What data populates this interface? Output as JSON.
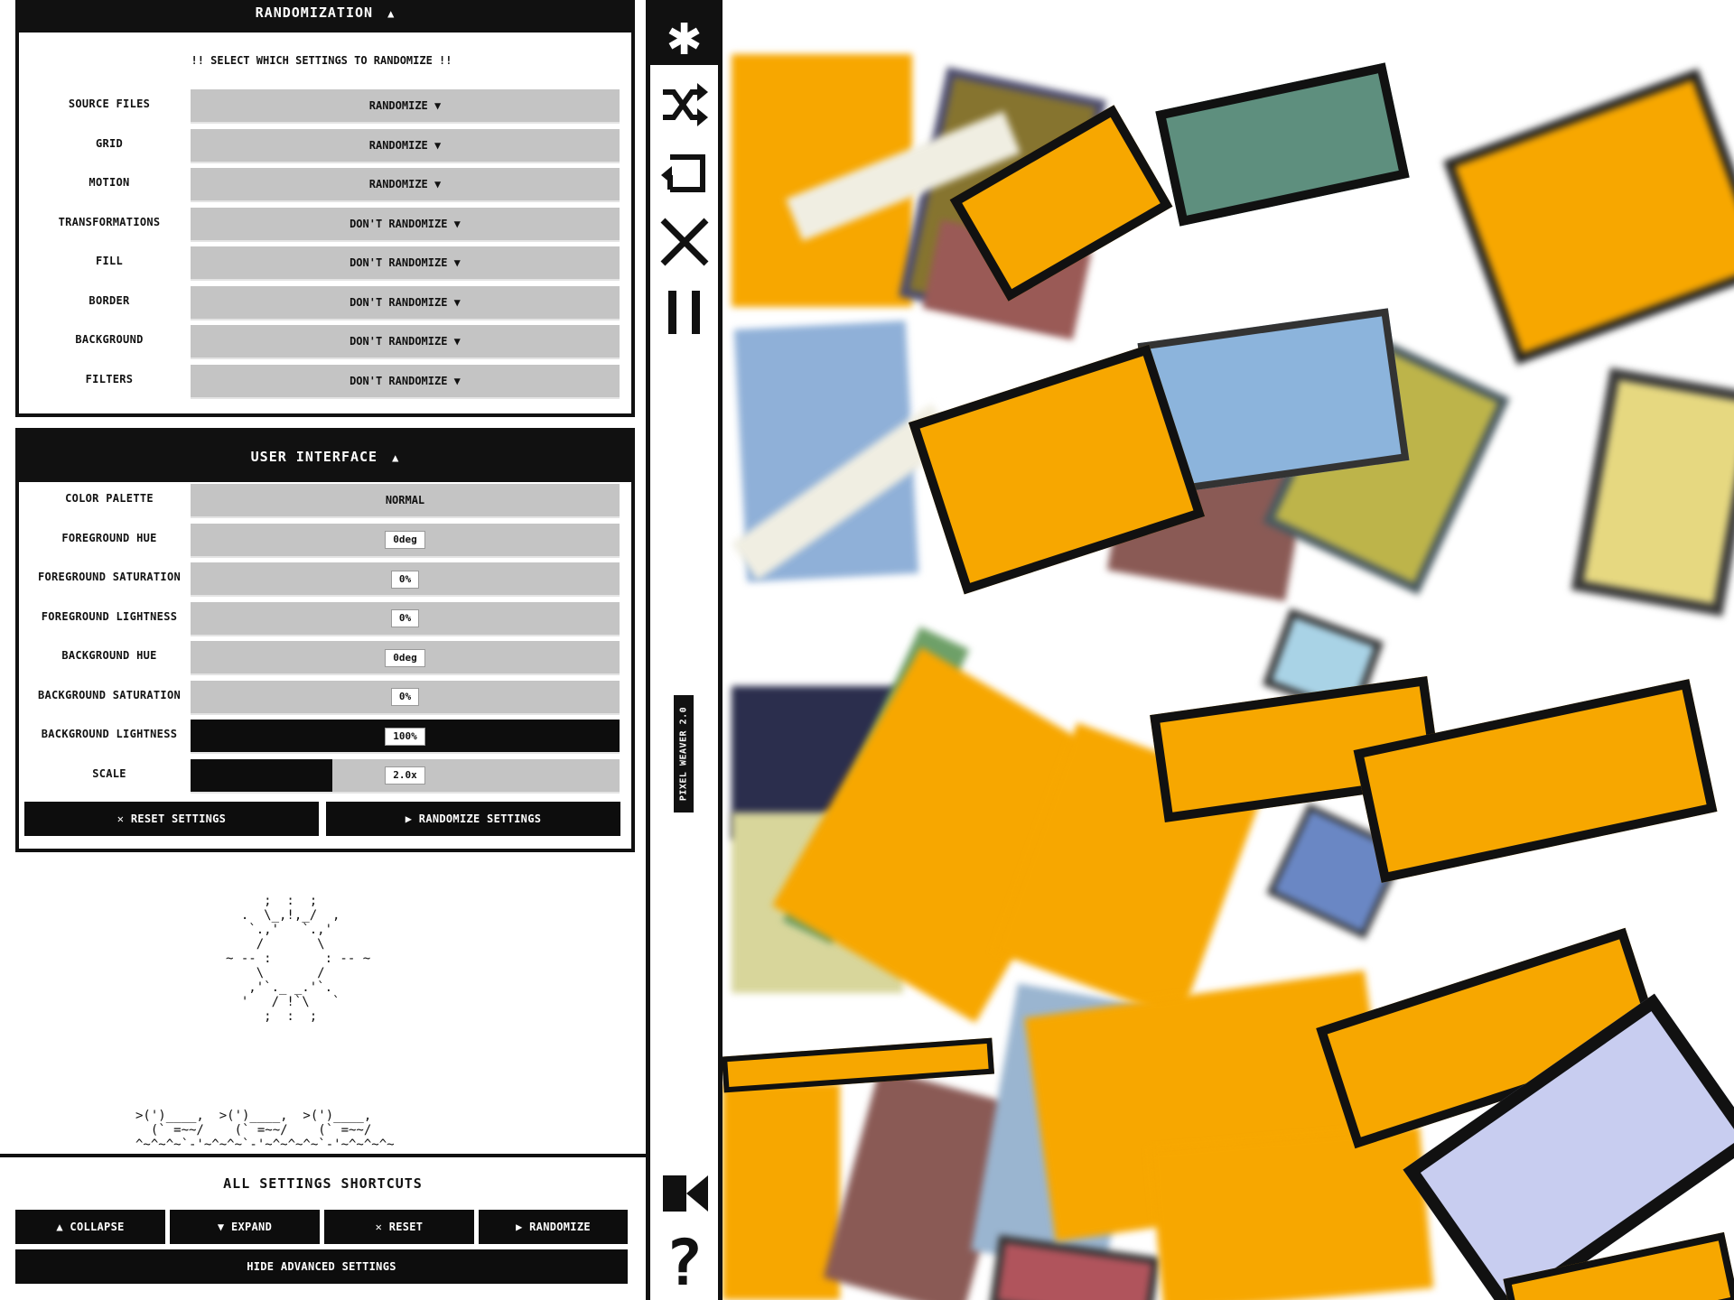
{
  "randomization": {
    "title": "RANDOMIZATION",
    "arrow": "▲",
    "instruction": "!! SELECT WHICH SETTINGS TO RANDOMIZE !!",
    "rows": [
      {
        "label": "SOURCE FILES",
        "value": "RANDOMIZE ▼"
      },
      {
        "label": "GRID",
        "value": "RANDOMIZE ▼"
      },
      {
        "label": "MOTION",
        "value": "RANDOMIZE ▼"
      },
      {
        "label": "TRANSFORMATIONS",
        "value": "DON'T RANDOMIZE ▼"
      },
      {
        "label": "FILL",
        "value": "DON'T RANDOMIZE ▼"
      },
      {
        "label": "BORDER",
        "value": "DON'T RANDOMIZE ▼"
      },
      {
        "label": "BACKGROUND",
        "value": "DON'T RANDOMIZE ▼"
      },
      {
        "label": "FILTERS",
        "value": "DON'T RANDOMIZE ▼"
      }
    ]
  },
  "user_interface": {
    "title": "USER INTERFACE",
    "arrow": "▲",
    "rows": [
      {
        "label": "COLOR PALETTE",
        "value": "NORMAL"
      },
      {
        "label": "FOREGROUND HUE",
        "value": "0deg"
      },
      {
        "label": "FOREGROUND SATURATION",
        "value": "0%"
      },
      {
        "label": "FOREGROUND LIGHTNESS",
        "value": "0%"
      },
      {
        "label": "BACKGROUND HUE",
        "value": "0deg"
      },
      {
        "label": "BACKGROUND SATURATION",
        "value": "0%"
      },
      {
        "label": "BACKGROUND LIGHTNESS",
        "value": "100%"
      },
      {
        "label": "SCALE",
        "value": "2.0x"
      }
    ],
    "scale_fraction": 0.33,
    "reset_label": "✕  RESET SETTINGS",
    "randomize_label": "▶  RANDOMIZE SETTINGS"
  },
  "ascii": {
    "sun": "     ;  :  ;\n  .  \\_,!,_/  ,\n   `.,'   `.,'\n    /       \\\n~ -- :       : -- ~\n    \\       /\n   ,'`._ _.'`.\n  '   / !`\\   `\n     ;  :  ;",
    "ducks": ">(')____,  >(')____,  >(')____,\n  (` =~~/    (` =~~/    (` =~~/\n^~^~^~`-'~^~^~`-'~^~^~^~`-'~^~^~^~"
  },
  "shortcuts": {
    "title": "ALL SETTINGS SHORTCUTS",
    "collapse": "▲  COLLAPSE",
    "expand": "▼  EXPAND",
    "reset": "✕  RESET",
    "randomize": "▶  RANDOMIZE",
    "hide_advanced": "HIDE ADVANCED SETTINGS"
  },
  "toolbar": {
    "brand": "PIXEL WEAVER 2.0",
    "icons": [
      "asterisk-icon",
      "shuffle-icon",
      "loop-icon",
      "close-icon",
      "pause-icon",
      "record-icon",
      "help-icon"
    ]
  },
  "colors": {
    "accent_orange": "#f7a700",
    "black": "#111111",
    "control_gray": "#c4c4c4"
  }
}
